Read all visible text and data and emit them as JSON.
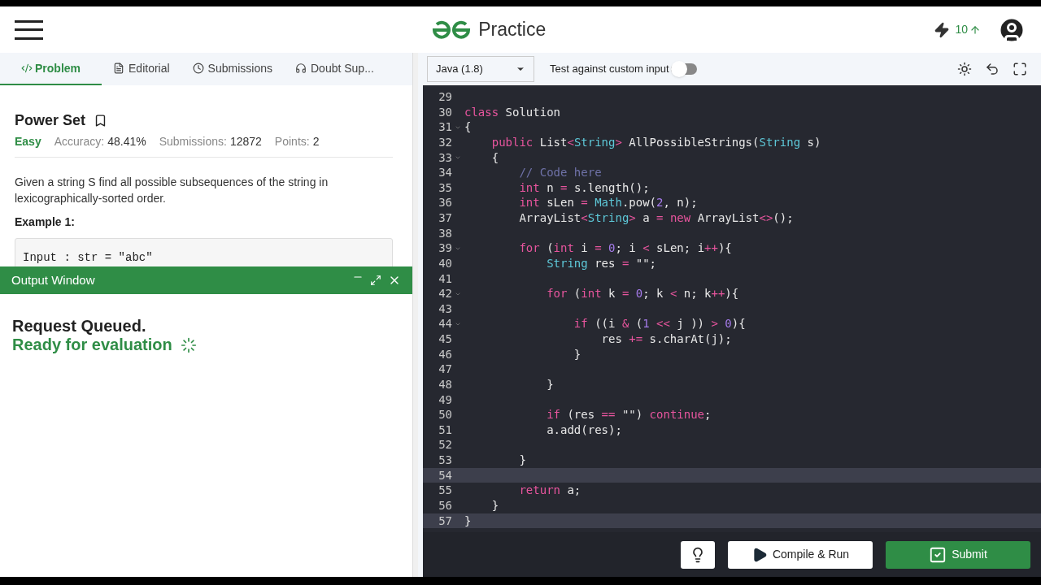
{
  "header": {
    "brand": "Practice",
    "streak": "10"
  },
  "tabs": [
    {
      "label": "Problem",
      "selected": true
    },
    {
      "label": "Editorial",
      "selected": false
    },
    {
      "label": "Submissions",
      "selected": false
    },
    {
      "label": "Doubt Sup...",
      "selected": false
    }
  ],
  "problem": {
    "title": "Power Set",
    "difficulty": "Easy",
    "accuracy_label": "Accuracy:",
    "accuracy": "48.41%",
    "submissions_label": "Submissions:",
    "submissions": "12872",
    "points_label": "Points:",
    "points": "2",
    "description": "Given a string S find all possible subsequences of the string in lexicographically-sorted order.",
    "example_title": "Example 1:",
    "example_input": "Input : str = \"abc\""
  },
  "output_window": {
    "title": "Output Window",
    "status": "Request Queued.",
    "message": "Ready for evaluation"
  },
  "editor": {
    "language": "Java (1.8)",
    "custom_input_label": "Test against custom input",
    "custom_input_on": false,
    "lines": [
      {
        "number": "29",
        "foldable": false,
        "highlighted": false
      },
      {
        "number": "30",
        "foldable": false,
        "highlighted": false,
        "tokens": [
          {
            "kind": "keyword",
            "text": "class"
          },
          {
            "kind": "plain",
            "text": " Solution"
          }
        ]
      },
      {
        "number": "31",
        "foldable": true,
        "highlighted": false,
        "tokens": [
          {
            "kind": "plain",
            "text": "{"
          }
        ]
      },
      {
        "number": "32",
        "foldable": false,
        "highlighted": false,
        "tokens": [
          {
            "kind": "keyword",
            "text": "    public"
          },
          {
            "kind": "plain",
            "text": " List"
          },
          {
            "kind": "operator",
            "text": "<"
          },
          {
            "kind": "type",
            "text": "String"
          },
          {
            "kind": "operator",
            "text": ">"
          },
          {
            "kind": "plain",
            "text": " AllPossibleStrings("
          },
          {
            "kind": "type",
            "text": "String"
          },
          {
            "kind": "plain",
            "text": " s)"
          }
        ]
      },
      {
        "number": "33",
        "foldable": true,
        "highlighted": false,
        "tokens": [
          {
            "kind": "plain",
            "text": "    {"
          }
        ]
      },
      {
        "number": "34",
        "foldable": false,
        "highlighted": false,
        "tokens": [
          {
            "kind": "comment",
            "text": "        // Code here"
          }
        ]
      },
      {
        "number": "35",
        "foldable": false,
        "highlighted": false,
        "tokens": [
          {
            "kind": "keyword",
            "text": "        int"
          },
          {
            "kind": "plain",
            "text": " n "
          },
          {
            "kind": "operator",
            "text": "="
          },
          {
            "kind": "plain",
            "text": " s.length();"
          }
        ]
      },
      {
        "number": "36",
        "foldable": false,
        "highlighted": false,
        "tokens": [
          {
            "kind": "keyword",
            "text": "        int"
          },
          {
            "kind": "plain",
            "text": " sLen "
          },
          {
            "kind": "operator",
            "text": "= "
          },
          {
            "kind": "type",
            "text": "Math"
          },
          {
            "kind": "plain",
            "text": ".pow("
          },
          {
            "kind": "number",
            "text": "2"
          },
          {
            "kind": "plain",
            "text": ", n);"
          }
        ]
      },
      {
        "number": "37",
        "foldable": false,
        "highlighted": false,
        "tokens": [
          {
            "kind": "plain",
            "text": "        ArrayList"
          },
          {
            "kind": "operator",
            "text": "<"
          },
          {
            "kind": "type",
            "text": "String"
          },
          {
            "kind": "operator",
            "text": ">"
          },
          {
            "kind": "plain",
            "text": " a "
          },
          {
            "kind": "operator",
            "text": "= "
          },
          {
            "kind": "keyword",
            "text": "new"
          },
          {
            "kind": "plain",
            "text": " ArrayList"
          },
          {
            "kind": "operator",
            "text": "<>"
          },
          {
            "kind": "plain",
            "text": "();"
          }
        ]
      },
      {
        "number": "38",
        "foldable": false,
        "highlighted": false
      },
      {
        "number": "39",
        "foldable": true,
        "highlighted": false,
        "tokens": [
          {
            "kind": "keyword",
            "text": "        for"
          },
          {
            "kind": "plain",
            "text": " ("
          },
          {
            "kind": "keyword",
            "text": "int"
          },
          {
            "kind": "plain",
            "text": " i "
          },
          {
            "kind": "operator",
            "text": "= "
          },
          {
            "kind": "number",
            "text": "0"
          },
          {
            "kind": "plain",
            "text": "; i "
          },
          {
            "kind": "operator",
            "text": "<"
          },
          {
            "kind": "plain",
            "text": " sLen; i"
          },
          {
            "kind": "operator",
            "text": "++"
          },
          {
            "kind": "plain",
            "text": "){"
          }
        ]
      },
      {
        "number": "40",
        "foldable": false,
        "highlighted": false,
        "tokens": [
          {
            "kind": "type",
            "text": "            String"
          },
          {
            "kind": "plain",
            "text": " res "
          },
          {
            "kind": "operator",
            "text": "= "
          },
          {
            "kind": "string",
            "text": "\"\""
          },
          {
            "kind": "plain",
            "text": ";"
          }
        ]
      },
      {
        "number": "41",
        "foldable": false,
        "highlighted": false
      },
      {
        "number": "42",
        "foldable": true,
        "highlighted": false,
        "tokens": [
          {
            "kind": "keyword",
            "text": "            for"
          },
          {
            "kind": "plain",
            "text": " ("
          },
          {
            "kind": "keyword",
            "text": "int"
          },
          {
            "kind": "plain",
            "text": " k "
          },
          {
            "kind": "operator",
            "text": "= "
          },
          {
            "kind": "number",
            "text": "0"
          },
          {
            "kind": "plain",
            "text": "; k "
          },
          {
            "kind": "operator",
            "text": "<"
          },
          {
            "kind": "plain",
            "text": " n; k"
          },
          {
            "kind": "operator",
            "text": "++"
          },
          {
            "kind": "plain",
            "text": "){"
          }
        ]
      },
      {
        "number": "43",
        "foldable": false,
        "highlighted": false
      },
      {
        "number": "44",
        "foldable": true,
        "highlighted": false,
        "tokens": [
          {
            "kind": "keyword",
            "text": "                if"
          },
          {
            "kind": "plain",
            "text": " ((i "
          },
          {
            "kind": "operator",
            "text": "&"
          },
          {
            "kind": "plain",
            "text": " ("
          },
          {
            "kind": "number",
            "text": "1"
          },
          {
            "kind": "operator",
            "text": " <<"
          },
          {
            "kind": "plain",
            "text": " j )) "
          },
          {
            "kind": "operator",
            "text": "> "
          },
          {
            "kind": "number",
            "text": "0"
          },
          {
            "kind": "plain",
            "text": "){"
          }
        ]
      },
      {
        "number": "45",
        "foldable": false,
        "highlighted": false,
        "tokens": [
          {
            "kind": "plain",
            "text": "                    res "
          },
          {
            "kind": "operator",
            "text": "+="
          },
          {
            "kind": "plain",
            "text": " s.charAt(j);"
          }
        ]
      },
      {
        "number": "46",
        "foldable": false,
        "highlighted": false,
        "tokens": [
          {
            "kind": "plain",
            "text": "                }"
          }
        ]
      },
      {
        "number": "47",
        "foldable": false,
        "highlighted": false
      },
      {
        "number": "48",
        "foldable": false,
        "highlighted": false,
        "tokens": [
          {
            "kind": "plain",
            "text": "            }"
          }
        ]
      },
      {
        "number": "49",
        "foldable": false,
        "highlighted": false
      },
      {
        "number": "50",
        "foldable": false,
        "highlighted": false,
        "tokens": [
          {
            "kind": "keyword",
            "text": "            if"
          },
          {
            "kind": "plain",
            "text": " (res "
          },
          {
            "kind": "operator",
            "text": "== "
          },
          {
            "kind": "string",
            "text": "\"\""
          },
          {
            "kind": "plain",
            "text": ") "
          },
          {
            "kind": "keyword",
            "text": "continue"
          },
          {
            "kind": "plain",
            "text": ";"
          }
        ]
      },
      {
        "number": "51",
        "foldable": false,
        "highlighted": false,
        "tokens": [
          {
            "kind": "plain",
            "text": "            a.add(res);"
          }
        ]
      },
      {
        "number": "52",
        "foldable": false,
        "highlighted": false
      },
      {
        "number": "53",
        "foldable": false,
        "highlighted": false,
        "tokens": [
          {
            "kind": "plain",
            "text": "        }"
          }
        ]
      },
      {
        "number": "54",
        "foldable": false,
        "highlighted": true
      },
      {
        "number": "55",
        "foldable": false,
        "highlighted": false,
        "tokens": [
          {
            "kind": "keyword",
            "text": "        return"
          },
          {
            "kind": "plain",
            "text": " a;"
          }
        ]
      },
      {
        "number": "56",
        "foldable": false,
        "highlighted": false,
        "tokens": [
          {
            "kind": "plain",
            "text": "    }"
          }
        ]
      },
      {
        "number": "57",
        "foldable": false,
        "highlighted": true,
        "tokens": [
          {
            "kind": "plain",
            "text": "}"
          }
        ]
      }
    ]
  },
  "actions": {
    "compile": "Compile & Run",
    "submit": "Submit"
  }
}
